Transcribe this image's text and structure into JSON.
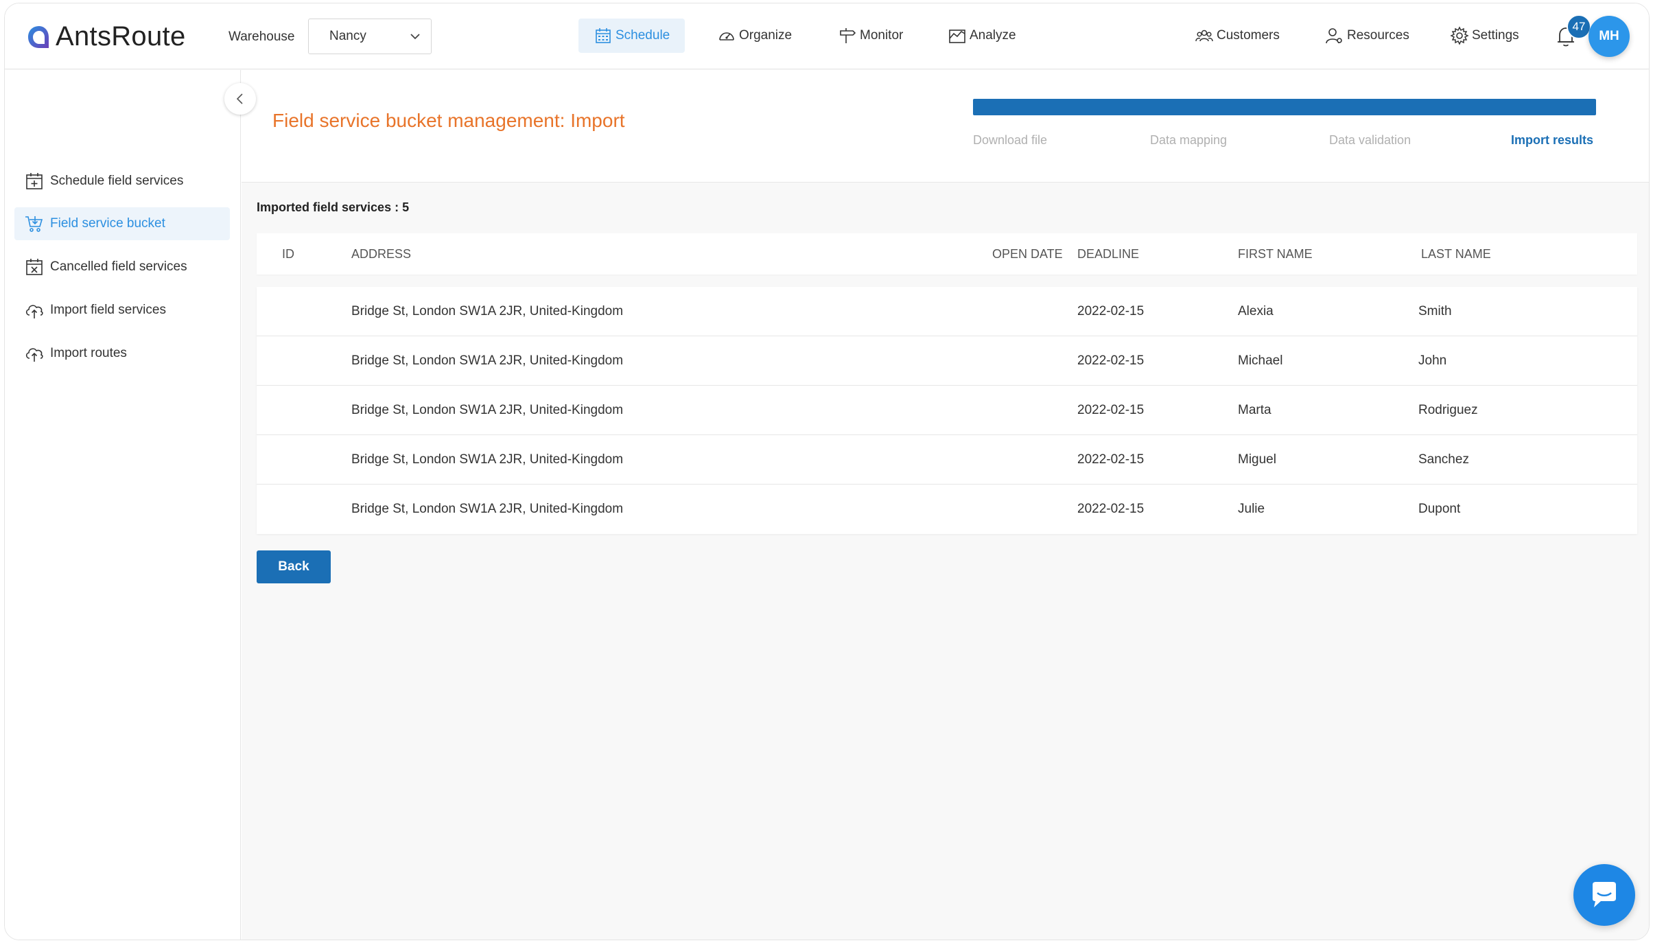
{
  "app": {
    "logo_light": "Ants",
    "logo_bold": "Route"
  },
  "warehouse": {
    "label": "Warehouse",
    "selected": "Nancy"
  },
  "nav": {
    "schedule": "Schedule",
    "organize": "Organize",
    "monitor": "Monitor",
    "analyze": "Analyze",
    "customers": "Customers",
    "resources": "Resources",
    "settings": "Settings"
  },
  "notifications": {
    "count": "47"
  },
  "user": {
    "initials": "MH"
  },
  "sidebar": {
    "items": [
      {
        "label": "Schedule field services",
        "icon": "calendar-plus-icon"
      },
      {
        "label": "Field service bucket",
        "icon": "cart-icon"
      },
      {
        "label": "Cancelled field services",
        "icon": "calendar-x-icon"
      },
      {
        "label": "Import field services",
        "icon": "cloud-upload-icon"
      },
      {
        "label": "Import routes",
        "icon": "cloud-upload-icon"
      }
    ]
  },
  "page": {
    "title": "Field service bucket management: Import",
    "steps": [
      "Download file",
      "Data mapping",
      "Data validation",
      "Import results"
    ],
    "current_step": "Import results",
    "progress": 1.0,
    "imported_label": "Imported field services : 5"
  },
  "table": {
    "headers": {
      "id": "ID",
      "address": "ADDRESS",
      "open_date": "OPEN DATE",
      "deadline": "DEADLINE",
      "first_name": "FIRST NAME",
      "last_name": "LAST NAME"
    },
    "rows": [
      {
        "id": "",
        "address": "Bridge St, London SW1A 2JR, United-Kingdom",
        "open_date": "",
        "deadline": "2022-02-15",
        "first_name": "Alexia",
        "last_name": "Smith"
      },
      {
        "id": "",
        "address": "Bridge St, London SW1A 2JR, United-Kingdom",
        "open_date": "",
        "deadline": "2022-02-15",
        "first_name": "Michael",
        "last_name": "John"
      },
      {
        "id": "",
        "address": "Bridge St, London SW1A 2JR, United-Kingdom",
        "open_date": "",
        "deadline": "2022-02-15",
        "first_name": "Marta",
        "last_name": "Rodriguez"
      },
      {
        "id": "",
        "address": "Bridge St, London SW1A 2JR, United-Kingdom",
        "open_date": "",
        "deadline": "2022-02-15",
        "first_name": "Miguel",
        "last_name": "Sanchez"
      },
      {
        "id": "",
        "address": "Bridge St, London SW1A 2JR, United-Kingdom",
        "open_date": "",
        "deadline": "2022-02-15",
        "first_name": "Julie",
        "last_name": "Dupont"
      }
    ]
  },
  "actions": {
    "back_label": "Back"
  },
  "colors": {
    "accent": "#1b6fb5",
    "title": "#e8742a",
    "active_nav": "#2c8fe0"
  }
}
